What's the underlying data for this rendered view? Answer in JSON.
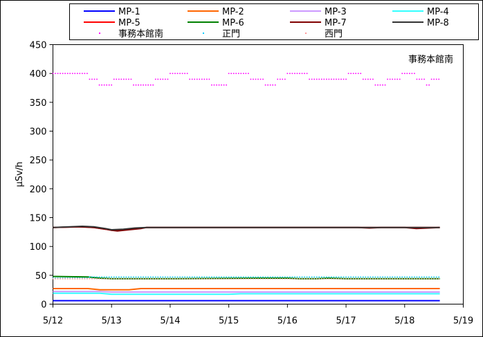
{
  "chart_data": {
    "type": "line",
    "title": "",
    "annotation": "事務本館南",
    "ylabel": "μSv/h",
    "xlabel": "",
    "ylim": [
      0,
      450
    ],
    "yticks": [
      0,
      50,
      100,
      150,
      200,
      250,
      300,
      350,
      400,
      450
    ],
    "xlim": [
      "5/12",
      "5/19"
    ],
    "xticks": [
      "5/12",
      "5/13",
      "5/14",
      "5/15",
      "5/16",
      "5/17",
      "5/18",
      "5/19"
    ],
    "grid": false,
    "legend_position": "top",
    "series": [
      {
        "name": "MP-1",
        "color": "#0000ff",
        "style": "line",
        "values": [
          [
            0,
            6
          ],
          [
            6.6,
            6
          ]
        ]
      },
      {
        "name": "MP-2",
        "color": "#ff6600",
        "style": "line",
        "values": [
          [
            0,
            27
          ],
          [
            0.6,
            27
          ],
          [
            0.8,
            25
          ],
          [
            1.3,
            25
          ],
          [
            1.5,
            27
          ],
          [
            6.6,
            27
          ]
        ]
      },
      {
        "name": "MP-3",
        "color": "#cc99ff",
        "style": "line",
        "values": [
          [
            0,
            22
          ],
          [
            0.8,
            22
          ],
          [
            1.0,
            21
          ],
          [
            6.6,
            21
          ]
        ]
      },
      {
        "name": "MP-4",
        "color": "#33ffff",
        "style": "line",
        "values": [
          [
            0,
            19
          ],
          [
            0.8,
            19
          ],
          [
            1.0,
            17
          ],
          [
            3.0,
            17
          ],
          [
            3.2,
            18
          ],
          [
            6.6,
            18
          ]
        ]
      },
      {
        "name": "MP-5",
        "color": "#ff0000",
        "style": "line",
        "values": [
          [
            0,
            133
          ],
          [
            0.5,
            134
          ],
          [
            0.7,
            133
          ],
          [
            0.9,
            130
          ],
          [
            1.0,
            128
          ],
          [
            1.2,
            129
          ],
          [
            1.4,
            131
          ],
          [
            1.6,
            133
          ],
          [
            6.6,
            133
          ]
        ]
      },
      {
        "name": "MP-6",
        "color": "#008000",
        "style": "line",
        "values": [
          [
            0,
            48
          ],
          [
            0.6,
            47
          ],
          [
            0.8,
            45
          ],
          [
            1.0,
            44
          ],
          [
            2.0,
            44
          ],
          [
            3.5,
            45
          ],
          [
            4.0,
            45
          ],
          [
            4.2,
            44
          ],
          [
            4.5,
            44
          ],
          [
            4.7,
            45
          ],
          [
            5.0,
            44
          ],
          [
            6.6,
            44
          ]
        ]
      },
      {
        "name": "MP-7",
        "color": "#800000",
        "style": "line",
        "values": [
          [
            0,
            133
          ],
          [
            0.4,
            134
          ],
          [
            0.7,
            133
          ],
          [
            0.9,
            130
          ],
          [
            1.0,
            128
          ],
          [
            1.1,
            127
          ],
          [
            1.3,
            129
          ],
          [
            1.5,
            131
          ],
          [
            1.6,
            133
          ],
          [
            5.2,
            133
          ],
          [
            5.4,
            132
          ],
          [
            5.6,
            133
          ],
          [
            6.0,
            133
          ],
          [
            6.2,
            131
          ],
          [
            6.4,
            132
          ],
          [
            6.6,
            133
          ]
        ]
      },
      {
        "name": "MP-8",
        "color": "#333333",
        "style": "line",
        "values": [
          [
            0,
            133
          ],
          [
            0.5,
            135
          ],
          [
            0.7,
            134
          ],
          [
            0.9,
            131
          ],
          [
            1.0,
            129
          ],
          [
            1.2,
            130
          ],
          [
            1.4,
            132
          ],
          [
            1.6,
            133
          ],
          [
            6.6,
            133
          ]
        ]
      },
      {
        "name": "事務本館南",
        "color": "#ff00ff",
        "style": "dots",
        "values": [
          [
            0,
            400
          ],
          [
            0.6,
            400
          ],
          [
            0.62,
            390
          ],
          [
            0.75,
            390
          ],
          [
            0.77,
            380
          ],
          [
            1.0,
            380
          ],
          [
            1.02,
            390
          ],
          [
            1.35,
            390
          ],
          [
            1.37,
            380
          ],
          [
            1.7,
            380
          ],
          [
            1.72,
            390
          ],
          [
            1.95,
            390
          ],
          [
            1.97,
            400
          ],
          [
            2.3,
            400
          ],
          [
            2.32,
            390
          ],
          [
            2.65,
            390
          ],
          [
            2.67,
            380
          ],
          [
            2.95,
            380
          ],
          [
            2.97,
            400
          ],
          [
            3.35,
            400
          ],
          [
            3.37,
            390
          ],
          [
            3.6,
            390
          ],
          [
            3.62,
            380
          ],
          [
            3.8,
            380
          ],
          [
            3.82,
            390
          ],
          [
            3.95,
            390
          ],
          [
            3.97,
            400
          ],
          [
            4.35,
            400
          ],
          [
            4.37,
            390
          ],
          [
            5.0,
            390
          ],
          [
            5.02,
            400
          ],
          [
            5.25,
            400
          ],
          [
            5.27,
            390
          ],
          [
            5.45,
            390
          ],
          [
            5.47,
            380
          ],
          [
            5.65,
            380
          ],
          [
            5.67,
            390
          ],
          [
            5.9,
            390
          ],
          [
            5.92,
            400
          ],
          [
            6.15,
            400
          ],
          [
            6.17,
            390
          ],
          [
            6.35,
            390
          ],
          [
            6.37,
            380
          ],
          [
            6.45,
            390
          ],
          [
            6.6,
            390
          ]
        ]
      },
      {
        "name": "正門",
        "color": "#00ccff",
        "style": "dots",
        "values": [
          [
            0,
            45
          ],
          [
            0.4,
            45
          ],
          [
            0.6,
            47
          ],
          [
            6.6,
            47
          ]
        ]
      },
      {
        "name": "西門",
        "color": "#ff9999",
        "style": "dots",
        "values": [
          [
            0,
            44
          ],
          [
            0.6,
            44
          ],
          [
            6.6,
            44
          ]
        ]
      }
    ]
  }
}
